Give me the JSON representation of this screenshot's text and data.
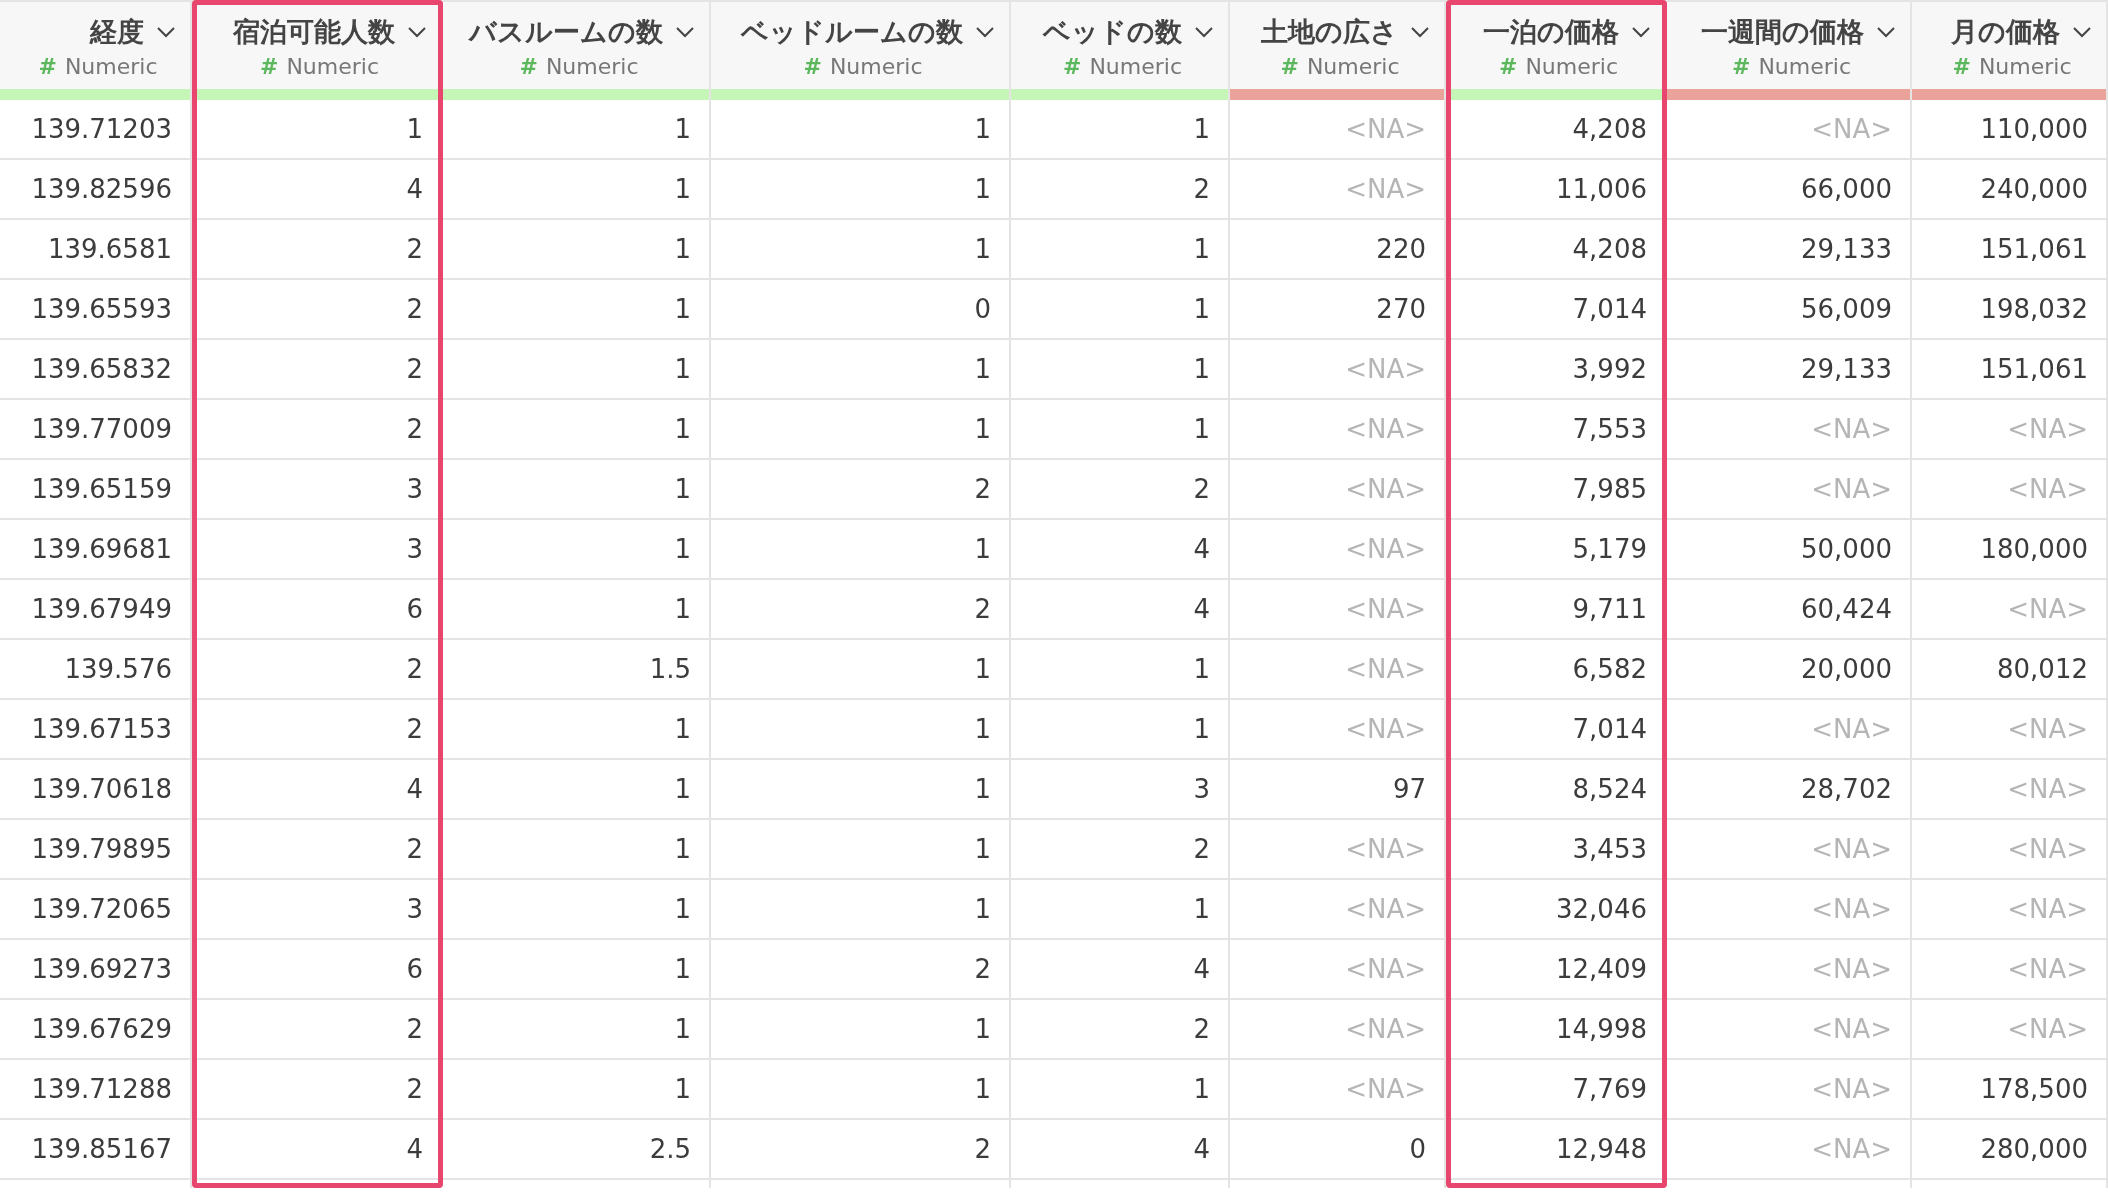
{
  "columns": [
    {
      "title": "経度",
      "type": "Numeric",
      "color": "#c6f5b8",
      "highlighted": false
    },
    {
      "title": "宿泊可能人数",
      "type": "Numeric",
      "color": "#c6f5b8",
      "highlighted": true
    },
    {
      "title": "バスルームの数",
      "type": "Numeric",
      "color": "#c6f5b8",
      "highlighted": false
    },
    {
      "title": "ベッドルームの数",
      "type": "Numeric",
      "color": "#c6f5b8",
      "highlighted": false
    },
    {
      "title": "ベッドの数",
      "type": "Numeric",
      "color": "#c6f5b8",
      "highlighted": false
    },
    {
      "title": "土地の広さ",
      "type": "Numeric",
      "color": "#e9a39a",
      "highlighted": false
    },
    {
      "title": "一泊の価格",
      "type": "Numeric",
      "color": "#c6f5b8",
      "highlighted": true
    },
    {
      "title": "一週間の価格",
      "type": "Numeric",
      "color": "#e9a39a",
      "highlighted": false
    },
    {
      "title": "月の価格",
      "type": "Numeric",
      "color": "#e9a39a",
      "highlighted": false
    }
  ],
  "type_symbol": "#",
  "rows": [
    [
      "139.71203",
      "1",
      "1",
      "1",
      "1",
      {
        "text": "<NA>",
        "missing": true
      },
      "4,208",
      {
        "text": "<NA>",
        "missing": true
      },
      "110,000"
    ],
    [
      "139.82596",
      "4",
      "1",
      "1",
      "2",
      {
        "text": "<NA>",
        "missing": true
      },
      "11,006",
      "66,000",
      "240,000"
    ],
    [
      "139.6581",
      "2",
      "1",
      "1",
      "1",
      "220",
      "4,208",
      "29,133",
      "151,061"
    ],
    [
      "139.65593",
      "2",
      "1",
      "0",
      "1",
      "270",
      "7,014",
      "56,009",
      "198,032"
    ],
    [
      "139.65832",
      "2",
      "1",
      "1",
      "1",
      {
        "text": "<NA>",
        "missing": true
      },
      "3,992",
      "29,133",
      "151,061"
    ],
    [
      "139.77009",
      "2",
      "1",
      "1",
      "1",
      {
        "text": "<NA>",
        "missing": true
      },
      "7,553",
      {
        "text": "<NA>",
        "missing": true
      },
      {
        "text": "<NA>",
        "missing": true
      }
    ],
    [
      "139.65159",
      "3",
      "1",
      "2",
      "2",
      {
        "text": "<NA>",
        "missing": true
      },
      "7,985",
      {
        "text": "<NA>",
        "missing": true
      },
      {
        "text": "<NA>",
        "missing": true
      }
    ],
    [
      "139.69681",
      "3",
      "1",
      "1",
      "4",
      {
        "text": "<NA>",
        "missing": true
      },
      "5,179",
      "50,000",
      "180,000"
    ],
    [
      "139.67949",
      "6",
      "1",
      "2",
      "4",
      {
        "text": "<NA>",
        "missing": true
      },
      "9,711",
      "60,424",
      {
        "text": "<NA>",
        "missing": true
      }
    ],
    [
      "139.576",
      "2",
      "1.5",
      "1",
      "1",
      {
        "text": "<NA>",
        "missing": true
      },
      "6,582",
      "20,000",
      "80,012"
    ],
    [
      "139.67153",
      "2",
      "1",
      "1",
      "1",
      {
        "text": "<NA>",
        "missing": true
      },
      "7,014",
      {
        "text": "<NA>",
        "missing": true
      },
      {
        "text": "<NA>",
        "missing": true
      }
    ],
    [
      "139.70618",
      "4",
      "1",
      "1",
      "3",
      "97",
      "8,524",
      "28,702",
      {
        "text": "<NA>",
        "missing": true
      }
    ],
    [
      "139.79895",
      "2",
      "1",
      "1",
      "2",
      {
        "text": "<NA>",
        "missing": true
      },
      "3,453",
      {
        "text": "<NA>",
        "missing": true
      },
      {
        "text": "<NA>",
        "missing": true
      }
    ],
    [
      "139.72065",
      "3",
      "1",
      "1",
      "1",
      {
        "text": "<NA>",
        "missing": true
      },
      "32,046",
      {
        "text": "<NA>",
        "missing": true
      },
      {
        "text": "<NA>",
        "missing": true
      }
    ],
    [
      "139.69273",
      "6",
      "1",
      "2",
      "4",
      {
        "text": "<NA>",
        "missing": true
      },
      "12,409",
      {
        "text": "<NA>",
        "missing": true
      },
      {
        "text": "<NA>",
        "missing": true
      }
    ],
    [
      "139.67629",
      "2",
      "1",
      "1",
      "2",
      {
        "text": "<NA>",
        "missing": true
      },
      "14,998",
      {
        "text": "<NA>",
        "missing": true
      },
      {
        "text": "<NA>",
        "missing": true
      }
    ],
    [
      "139.71288",
      "2",
      "1",
      "1",
      "1",
      {
        "text": "<NA>",
        "missing": true
      },
      "7,769",
      {
        "text": "<NA>",
        "missing": true
      },
      "178,500"
    ],
    [
      "139.85167",
      "4",
      "2.5",
      "2",
      "4",
      "0",
      "12,948",
      {
        "text": "<NA>",
        "missing": true
      },
      "280,000"
    ]
  ]
}
